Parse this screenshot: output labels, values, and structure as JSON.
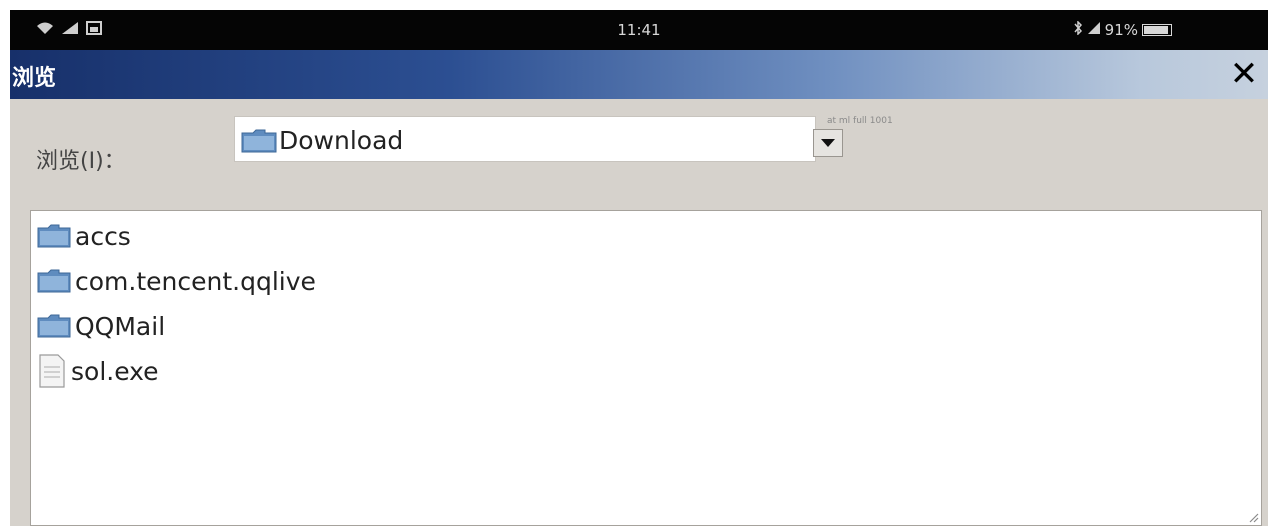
{
  "status_bar": {
    "left_icons": [
      "wifi-icon",
      "signal-icon",
      "image-icon"
    ],
    "time": "11:41",
    "right_text": "91%",
    "battery_percent": 91,
    "right_icons": [
      "bluetooth-icon",
      "signal-icon",
      "battery-icon"
    ]
  },
  "dialog": {
    "title": "浏览",
    "close_label": "✕",
    "look_in_label": "浏览(I)：",
    "look_in_value": "Download",
    "look_in_icon": "folder-icon",
    "toolbar_hint": "at ml full 1001"
  },
  "files": [
    {
      "name": "accs",
      "type": "folder",
      "icon": "folder-icon"
    },
    {
      "name": "com.tencent.qqlive",
      "type": "folder",
      "icon": "folder-icon"
    },
    {
      "name": "QQMail",
      "type": "folder",
      "icon": "folder-icon"
    },
    {
      "name": "sol.exe",
      "type": "file",
      "icon": "file-icon"
    }
  ],
  "colors": {
    "title_gradient_start": "#17306a",
    "title_gradient_end": "#c6d1de",
    "window_bg": "#d6d2cc",
    "folder_blue": "#5f8cbf"
  }
}
